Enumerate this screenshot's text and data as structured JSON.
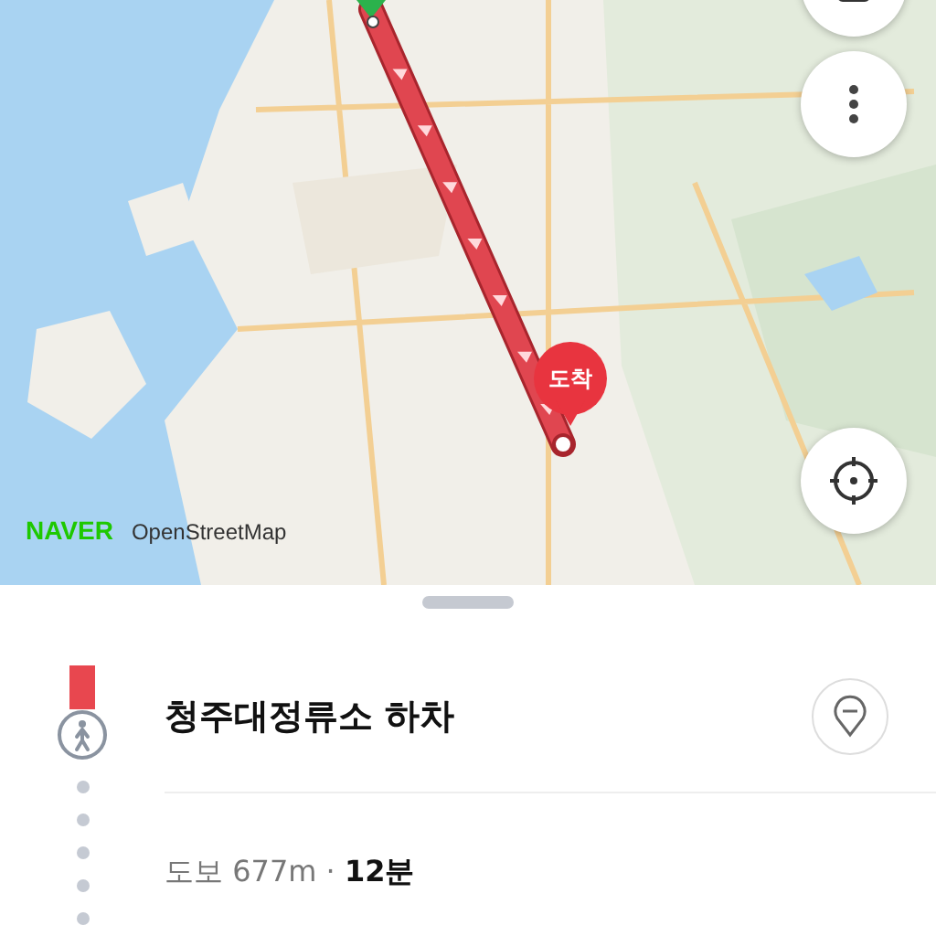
{
  "map": {
    "kind": "picture",
    "destination_marker": "도착",
    "logo": "NAVER",
    "attribution": "OpenStreetMap"
  },
  "sheet": {
    "step": {
      "title": "청주대정류소 하차",
      "walk": "도보 677m · **12분**"
    }
  }
}
